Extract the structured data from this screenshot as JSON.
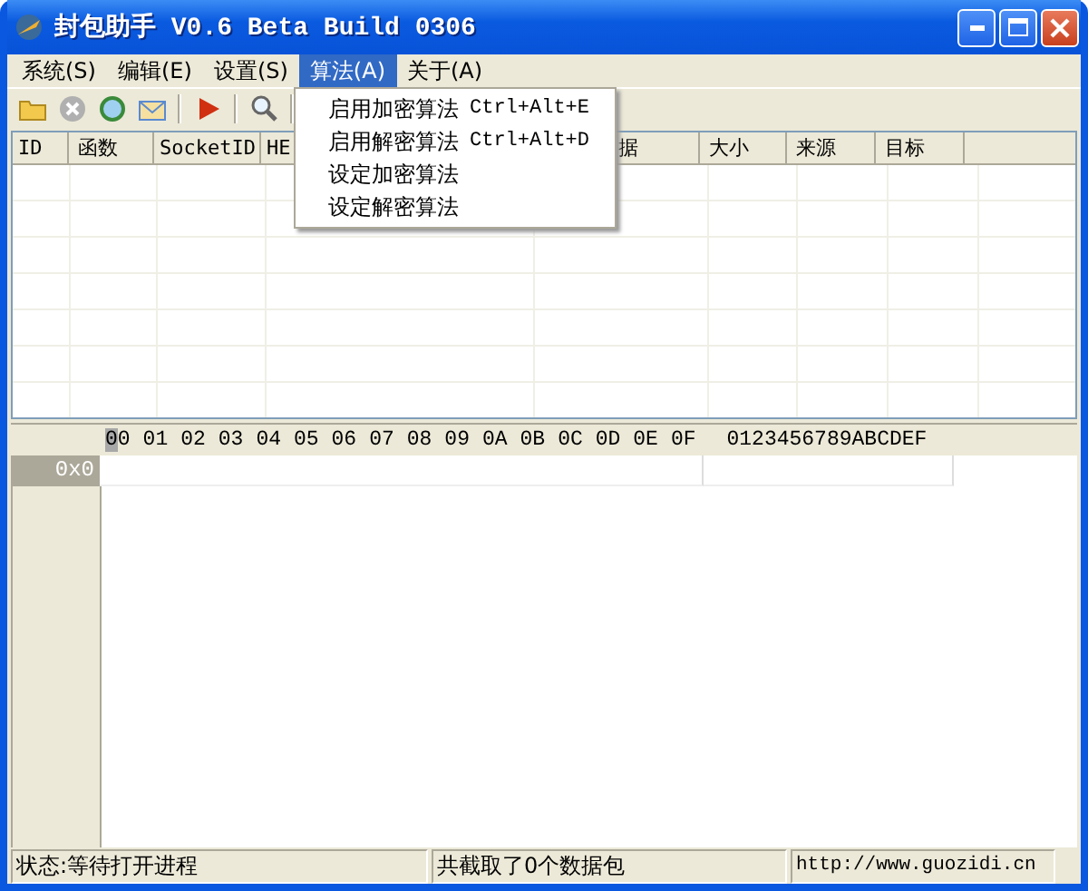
{
  "window": {
    "title": "封包助手 V0.6 Beta Build 0306"
  },
  "menu": [
    {
      "label": "系统(S)",
      "selected": false
    },
    {
      "label": "编辑(E)",
      "selected": false
    },
    {
      "label": "设置(S)",
      "selected": false
    },
    {
      "label": "算法(A)",
      "selected": true
    },
    {
      "label": "关于(A)",
      "selected": false
    }
  ],
  "dropdown": [
    {
      "label": "启用加密算法",
      "shortcut": "Ctrl+Alt+E"
    },
    {
      "label": "启用解密算法",
      "shortcut": "Ctrl+Alt+D"
    },
    {
      "label": "设定加密算法"
    },
    {
      "label": "设定解密算法"
    }
  ],
  "packet_table": {
    "columns": [
      "ID",
      "函数",
      "SocketID",
      "HE",
      "据",
      "大小",
      "来源",
      "目标"
    ]
  },
  "hex_view": {
    "columns": [
      "00",
      "01",
      "02",
      "03",
      "04",
      "05",
      "06",
      "07",
      "08",
      "09",
      "0A",
      "0B",
      "0C",
      "0D",
      "0E",
      "0F"
    ],
    "ascii_header": "0123456789ABCDEF",
    "rows": [
      {
        "offset": "0x0"
      }
    ]
  },
  "status_bar": [
    "状态:等待打开进程",
    "共截取了0个数据包",
    "http://www.guozidi.cn"
  ]
}
